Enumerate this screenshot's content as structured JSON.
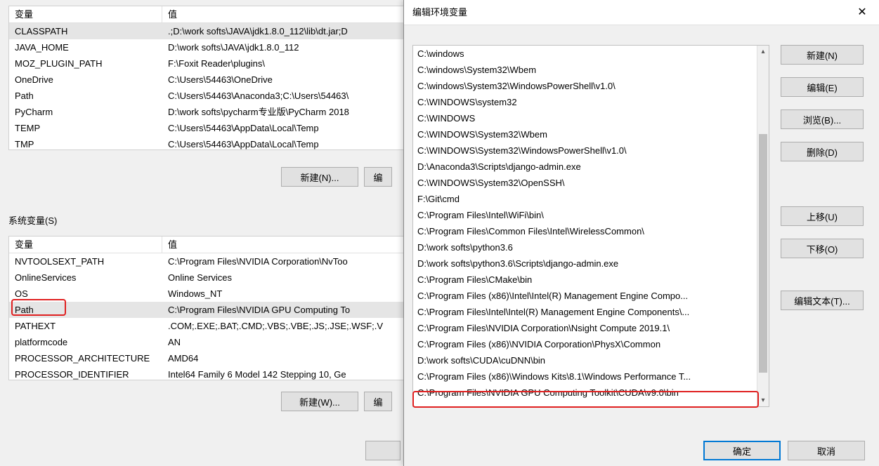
{
  "sysvars_label": "系统变量(S)",
  "headers": {
    "variable": "变量",
    "value": "值"
  },
  "user_vars": [
    {
      "name": "CLASSPATH",
      "value": ".;D:\\work softs\\JAVA\\jdk1.8.0_112\\lib\\dt.jar;D"
    },
    {
      "name": "JAVA_HOME",
      "value": "D:\\work softs\\JAVA\\jdk1.8.0_112"
    },
    {
      "name": "MOZ_PLUGIN_PATH",
      "value": "F:\\Foxit Reader\\plugins\\"
    },
    {
      "name": "OneDrive",
      "value": "C:\\Users\\54463\\OneDrive"
    },
    {
      "name": "Path",
      "value": "C:\\Users\\54463\\Anaconda3;C:\\Users\\54463\\"
    },
    {
      "name": "PyCharm",
      "value": "D:\\work softs\\pycharm专业版\\PyCharm 2018"
    },
    {
      "name": "TEMP",
      "value": "C:\\Users\\54463\\AppData\\Local\\Temp"
    },
    {
      "name": "TMP",
      "value": "C:\\Users\\54463\\AppData\\Local\\Temp"
    }
  ],
  "sys_vars": [
    {
      "name": "NVTOOLSEXT_PATH",
      "value": "C:\\Program Files\\NVIDIA Corporation\\NvToo"
    },
    {
      "name": "OnlineServices",
      "value": "Online Services"
    },
    {
      "name": "OS",
      "value": "Windows_NT"
    },
    {
      "name": "Path",
      "value": "C:\\Program Files\\NVIDIA GPU Computing To"
    },
    {
      "name": "PATHEXT",
      "value": ".COM;.EXE;.BAT;.CMD;.VBS;.VBE;.JS;.JSE;.WSF;.V"
    },
    {
      "name": "platformcode",
      "value": "AN"
    },
    {
      "name": "PROCESSOR_ARCHITECTURE",
      "value": "AMD64"
    },
    {
      "name": "PROCESSOR_IDENTIFIER",
      "value": "Intel64 Family 6 Model 142 Stepping 10, Ge"
    }
  ],
  "buttons": {
    "new_n": "新建(N)...",
    "edit_partial": "编",
    "new_w": "新建(W)...",
    "edit_partial2": "编"
  },
  "dialog": {
    "title": "编辑环境变量",
    "items": [
      "C:\\windows",
      "C:\\windows\\System32\\Wbem",
      "C:\\windows\\System32\\WindowsPowerShell\\v1.0\\",
      "C:\\WINDOWS\\system32",
      "C:\\WINDOWS",
      "C:\\WINDOWS\\System32\\Wbem",
      "C:\\WINDOWS\\System32\\WindowsPowerShell\\v1.0\\",
      "D:\\Anaconda3\\Scripts\\django-admin.exe",
      "C:\\WINDOWS\\System32\\OpenSSH\\",
      "F:\\Git\\cmd",
      "C:\\Program Files\\Intel\\WiFi\\bin\\",
      "C:\\Program Files\\Common Files\\Intel\\WirelessCommon\\",
      "D:\\work softs\\python3.6",
      "D:\\work softs\\python3.6\\Scripts\\django-admin.exe",
      "C:\\Program Files\\CMake\\bin",
      "C:\\Program Files (x86)\\Intel\\Intel(R) Management Engine Compo...",
      "C:\\Program Files\\Intel\\Intel(R) Management Engine Components\\...",
      "C:\\Program Files\\NVIDIA Corporation\\Nsight Compute 2019.1\\",
      "C:\\Program Files (x86)\\NVIDIA Corporation\\PhysX\\Common",
      "D:\\work softs\\CUDA\\cuDNN\\bin",
      "C:\\Program Files (x86)\\Windows Kits\\8.1\\Windows Performance T...",
      "C:\\Program Files\\NVIDIA GPU Computing Toolkit\\CUDA\\v9.0\\bin"
    ],
    "buttons": {
      "new": "新建(N)",
      "edit": "编辑(E)",
      "browse": "浏览(B)...",
      "delete": "删除(D)",
      "moveup": "上移(U)",
      "movedown": "下移(O)",
      "edittext": "编辑文本(T)...",
      "ok": "确定",
      "cancel": "取消"
    }
  }
}
